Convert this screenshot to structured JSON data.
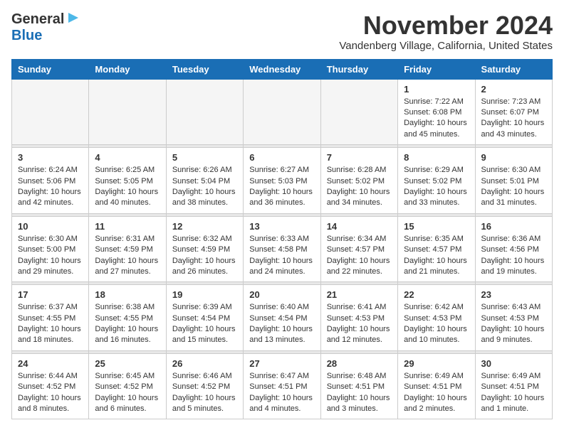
{
  "header": {
    "logo_line1": "General",
    "logo_line2": "Blue",
    "month": "November 2024",
    "location": "Vandenberg Village, California, United States"
  },
  "weekdays": [
    "Sunday",
    "Monday",
    "Tuesday",
    "Wednesday",
    "Thursday",
    "Friday",
    "Saturday"
  ],
  "weeks": [
    [
      {
        "day": "",
        "empty": true
      },
      {
        "day": "",
        "empty": true
      },
      {
        "day": "",
        "empty": true
      },
      {
        "day": "",
        "empty": true
      },
      {
        "day": "",
        "empty": true
      },
      {
        "day": "1",
        "sunrise": "Sunrise: 7:22 AM",
        "sunset": "Sunset: 6:08 PM",
        "daylight": "Daylight: 10 hours and 45 minutes."
      },
      {
        "day": "2",
        "sunrise": "Sunrise: 7:23 AM",
        "sunset": "Sunset: 6:07 PM",
        "daylight": "Daylight: 10 hours and 43 minutes."
      }
    ],
    [
      {
        "day": "3",
        "sunrise": "Sunrise: 6:24 AM",
        "sunset": "Sunset: 5:06 PM",
        "daylight": "Daylight: 10 hours and 42 minutes."
      },
      {
        "day": "4",
        "sunrise": "Sunrise: 6:25 AM",
        "sunset": "Sunset: 5:05 PM",
        "daylight": "Daylight: 10 hours and 40 minutes."
      },
      {
        "day": "5",
        "sunrise": "Sunrise: 6:26 AM",
        "sunset": "Sunset: 5:04 PM",
        "daylight": "Daylight: 10 hours and 38 minutes."
      },
      {
        "day": "6",
        "sunrise": "Sunrise: 6:27 AM",
        "sunset": "Sunset: 5:03 PM",
        "daylight": "Daylight: 10 hours and 36 minutes."
      },
      {
        "day": "7",
        "sunrise": "Sunrise: 6:28 AM",
        "sunset": "Sunset: 5:02 PM",
        "daylight": "Daylight: 10 hours and 34 minutes."
      },
      {
        "day": "8",
        "sunrise": "Sunrise: 6:29 AM",
        "sunset": "Sunset: 5:02 PM",
        "daylight": "Daylight: 10 hours and 33 minutes."
      },
      {
        "day": "9",
        "sunrise": "Sunrise: 6:30 AM",
        "sunset": "Sunset: 5:01 PM",
        "daylight": "Daylight: 10 hours and 31 minutes."
      }
    ],
    [
      {
        "day": "10",
        "sunrise": "Sunrise: 6:30 AM",
        "sunset": "Sunset: 5:00 PM",
        "daylight": "Daylight: 10 hours and 29 minutes."
      },
      {
        "day": "11",
        "sunrise": "Sunrise: 6:31 AM",
        "sunset": "Sunset: 4:59 PM",
        "daylight": "Daylight: 10 hours and 27 minutes."
      },
      {
        "day": "12",
        "sunrise": "Sunrise: 6:32 AM",
        "sunset": "Sunset: 4:59 PM",
        "daylight": "Daylight: 10 hours and 26 minutes."
      },
      {
        "day": "13",
        "sunrise": "Sunrise: 6:33 AM",
        "sunset": "Sunset: 4:58 PM",
        "daylight": "Daylight: 10 hours and 24 minutes."
      },
      {
        "day": "14",
        "sunrise": "Sunrise: 6:34 AM",
        "sunset": "Sunset: 4:57 PM",
        "daylight": "Daylight: 10 hours and 22 minutes."
      },
      {
        "day": "15",
        "sunrise": "Sunrise: 6:35 AM",
        "sunset": "Sunset: 4:57 PM",
        "daylight": "Daylight: 10 hours and 21 minutes."
      },
      {
        "day": "16",
        "sunrise": "Sunrise: 6:36 AM",
        "sunset": "Sunset: 4:56 PM",
        "daylight": "Daylight: 10 hours and 19 minutes."
      }
    ],
    [
      {
        "day": "17",
        "sunrise": "Sunrise: 6:37 AM",
        "sunset": "Sunset: 4:55 PM",
        "daylight": "Daylight: 10 hours and 18 minutes."
      },
      {
        "day": "18",
        "sunrise": "Sunrise: 6:38 AM",
        "sunset": "Sunset: 4:55 PM",
        "daylight": "Daylight: 10 hours and 16 minutes."
      },
      {
        "day": "19",
        "sunrise": "Sunrise: 6:39 AM",
        "sunset": "Sunset: 4:54 PM",
        "daylight": "Daylight: 10 hours and 15 minutes."
      },
      {
        "day": "20",
        "sunrise": "Sunrise: 6:40 AM",
        "sunset": "Sunset: 4:54 PM",
        "daylight": "Daylight: 10 hours and 13 minutes."
      },
      {
        "day": "21",
        "sunrise": "Sunrise: 6:41 AM",
        "sunset": "Sunset: 4:53 PM",
        "daylight": "Daylight: 10 hours and 12 minutes."
      },
      {
        "day": "22",
        "sunrise": "Sunrise: 6:42 AM",
        "sunset": "Sunset: 4:53 PM",
        "daylight": "Daylight: 10 hours and 10 minutes."
      },
      {
        "day": "23",
        "sunrise": "Sunrise: 6:43 AM",
        "sunset": "Sunset: 4:53 PM",
        "daylight": "Daylight: 10 hours and 9 minutes."
      }
    ],
    [
      {
        "day": "24",
        "sunrise": "Sunrise: 6:44 AM",
        "sunset": "Sunset: 4:52 PM",
        "daylight": "Daylight: 10 hours and 8 minutes."
      },
      {
        "day": "25",
        "sunrise": "Sunrise: 6:45 AM",
        "sunset": "Sunset: 4:52 PM",
        "daylight": "Daylight: 10 hours and 6 minutes."
      },
      {
        "day": "26",
        "sunrise": "Sunrise: 6:46 AM",
        "sunset": "Sunset: 4:52 PM",
        "daylight": "Daylight: 10 hours and 5 minutes."
      },
      {
        "day": "27",
        "sunrise": "Sunrise: 6:47 AM",
        "sunset": "Sunset: 4:51 PM",
        "daylight": "Daylight: 10 hours and 4 minutes."
      },
      {
        "day": "28",
        "sunrise": "Sunrise: 6:48 AM",
        "sunset": "Sunset: 4:51 PM",
        "daylight": "Daylight: 10 hours and 3 minutes."
      },
      {
        "day": "29",
        "sunrise": "Sunrise: 6:49 AM",
        "sunset": "Sunset: 4:51 PM",
        "daylight": "Daylight: 10 hours and 2 minutes."
      },
      {
        "day": "30",
        "sunrise": "Sunrise: 6:49 AM",
        "sunset": "Sunset: 4:51 PM",
        "daylight": "Daylight: 10 hours and 1 minute."
      }
    ]
  ]
}
